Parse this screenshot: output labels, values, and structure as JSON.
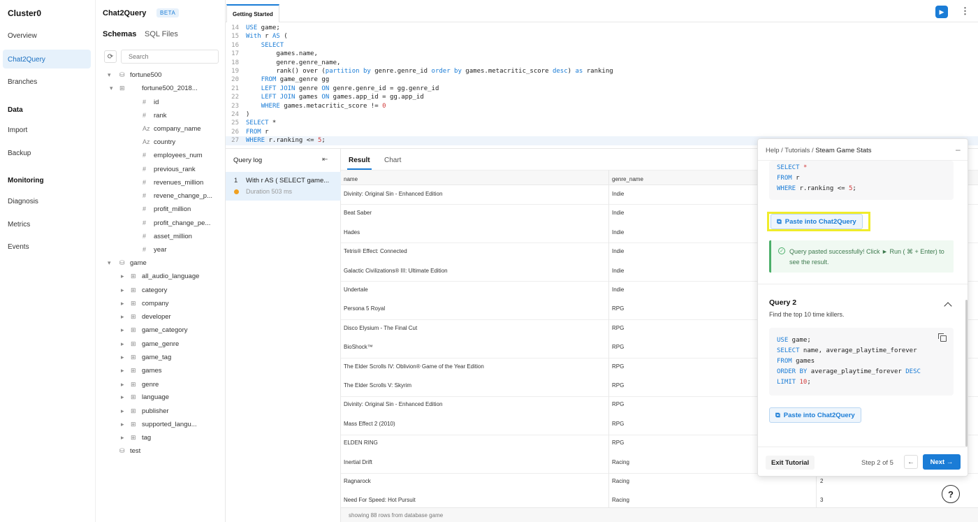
{
  "nav": {
    "cluster": "Cluster0",
    "items": [
      "Overview",
      "Chat2Query",
      "Branches"
    ],
    "data_section": "Data",
    "data_items": [
      "Import",
      "Backup"
    ],
    "monitoring_section": "Monitoring",
    "monitoring_items": [
      "Diagnosis",
      "Metrics",
      "Events"
    ]
  },
  "schema": {
    "title": "Chat2Query",
    "badge": "BETA",
    "tabs": [
      "Schemas",
      "SQL Files"
    ],
    "search_placeholder": "Search",
    "db1": "fortune500",
    "db1_table": "fortune500_2018...",
    "db1_columns": [
      "id",
      "rank",
      "company_name",
      "country",
      "employees_num",
      "previous_rank",
      "revenues_million",
      "revene_change_p...",
      "profit_million",
      "profit_change_pe...",
      "asset_million",
      "year"
    ],
    "db2": "game",
    "db2_tables": [
      "all_audio_language",
      "category",
      "company",
      "developer",
      "game_category",
      "game_genre",
      "game_tag",
      "games",
      "genre",
      "language",
      "publisher",
      "supported_langu...",
      "tag"
    ],
    "db3": "test"
  },
  "editor": {
    "tab": "Getting Started",
    "lines": [
      {
        "n": "14",
        "t": "USE game;"
      },
      {
        "n": "15",
        "t": "With r AS ("
      },
      {
        "n": "16",
        "t": "    SELECT"
      },
      {
        "n": "17",
        "t": "        games.name,"
      },
      {
        "n": "18",
        "t": "        genre.genre_name,"
      },
      {
        "n": "19",
        "t": "        rank() over (partition by genre.genre_id order by games.metacritic_score desc) as ranking"
      },
      {
        "n": "20",
        "t": "    FROM game_genre gg"
      },
      {
        "n": "21",
        "t": "    LEFT JOIN genre ON genre.genre_id = gg.genre_id"
      },
      {
        "n": "22",
        "t": "    LEFT JOIN games ON games.app_id = gg.app_id"
      },
      {
        "n": "23",
        "t": "    WHERE games.metacritic_score != 0"
      },
      {
        "n": "24",
        "t": ")"
      },
      {
        "n": "25",
        "t": "SELECT *"
      },
      {
        "n": "26",
        "t": "FROM r"
      },
      {
        "n": "27",
        "t": "WHERE r.ranking <= 5;"
      }
    ]
  },
  "query_log": {
    "title": "Query log",
    "entry_num": "1",
    "entry_text": "With r AS ( SELECT game...",
    "duration": "Duration 503 ms"
  },
  "results": {
    "tabs": [
      "Result",
      "Chart"
    ],
    "columns": [
      "name",
      "genre_name"
    ],
    "rows": [
      {
        "name": "Divinity: Original Sin - Enhanced Edition",
        "genre": "Indie",
        "rank": ""
      },
      {
        "name": "Beat Saber",
        "genre": "Indie",
        "rank": ""
      },
      {
        "name": "Hades",
        "genre": "Indie",
        "rank": ""
      },
      {
        "name": "Tetris® Effect: Connected",
        "genre": "Indie",
        "rank": ""
      },
      {
        "name": "Galactic Civilizations® III: Ultimate Edition",
        "genre": "Indie",
        "rank": ""
      },
      {
        "name": "Undertale",
        "genre": "Indie",
        "rank": ""
      },
      {
        "name": "Persona 5 Royal",
        "genre": "RPG",
        "rank": ""
      },
      {
        "name": "Disco Elysium - The Final Cut",
        "genre": "RPG",
        "rank": ""
      },
      {
        "name": "BioShock™",
        "genre": "RPG",
        "rank": ""
      },
      {
        "name": "The Elder Scrolls IV: Oblivion® Game of the Year Edition",
        "genre": "RPG",
        "rank": ""
      },
      {
        "name": "The Elder Scrolls V: Skyrim",
        "genre": "RPG",
        "rank": ""
      },
      {
        "name": "Divinity: Original Sin - Enhanced Edition",
        "genre": "RPG",
        "rank": ""
      },
      {
        "name": "Mass Effect 2 (2010)",
        "genre": "RPG",
        "rank": ""
      },
      {
        "name": "ELDEN RING",
        "genre": "RPG",
        "rank": ""
      },
      {
        "name": "Inertial Drift",
        "genre": "Racing",
        "rank": ""
      },
      {
        "name": "Ragnarock",
        "genre": "Racing",
        "rank": "2"
      },
      {
        "name": "Need For Speed: Hot Pursuit",
        "genre": "Racing",
        "rank": "3"
      }
    ],
    "footer": "showing 88 rows from database game"
  },
  "help": {
    "crumb_help": "Help",
    "crumb_tutorials": "Tutorials",
    "crumb_current": "Steam Game Stats",
    "code1": [
      "SELECT *",
      "FROM r",
      "WHERE r.ranking <= 5;"
    ],
    "paste_label": "Paste into Chat2Query",
    "success_msg": "Query pasted successfully! Click ► Run ( ⌘ + Enter) to see the result.",
    "q2_title": "Query 2",
    "q2_desc": "Find the top 10 time killers.",
    "code2": [
      "USE game;",
      "SELECT name, average_playtime_forever",
      "FROM games",
      "ORDER BY average_playtime_forever DESC",
      "LIMIT 10;"
    ],
    "exit_label": "Exit Tutorial",
    "step": "Step 2 of 5",
    "next_label": "Next →"
  },
  "help_button": "?",
  "colors": {
    "accent": "#1a7cd6",
    "highlight": "#f0ec2b",
    "success": "#4caf6a"
  }
}
